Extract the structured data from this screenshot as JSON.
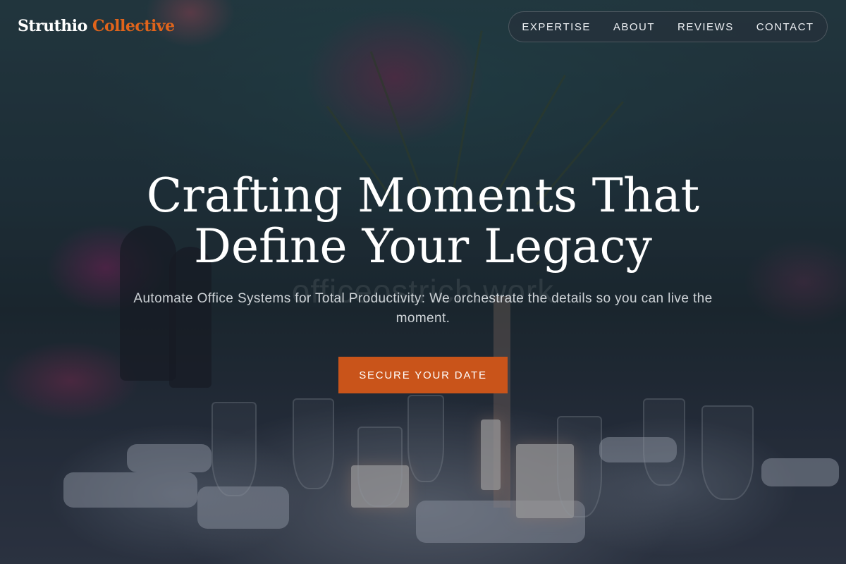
{
  "brand": {
    "name_primary": "Struthio",
    "name_accent": "Collective"
  },
  "nav": {
    "items": [
      {
        "label": "EXPERTISE"
      },
      {
        "label": "ABOUT"
      },
      {
        "label": "REVIEWS"
      },
      {
        "label": "CONTACT"
      }
    ]
  },
  "hero": {
    "headline_line1": "Crafting Moments That",
    "headline_line2": "Define Your Legacy",
    "subtitle": "Automate Office Systems for Total Productivity: We orchestrate the details so you can live the moment.",
    "watermark": "officeostrich.work",
    "cta_label": "SECURE YOUR DATE",
    "background": "event-table-photo"
  },
  "colors": {
    "accent": "#e0641b",
    "cta": "#c9541a",
    "text": "#ffffff"
  }
}
